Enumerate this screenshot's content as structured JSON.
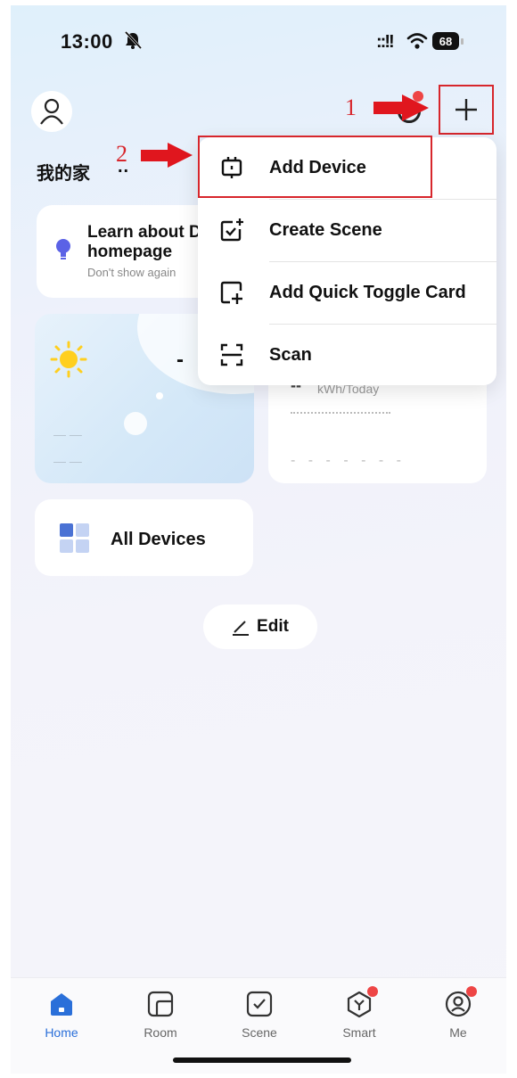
{
  "status_bar": {
    "time": "13:00",
    "signal": "::!!",
    "battery": "68"
  },
  "header": {
    "home_title": "我的家",
    "home_dots": ".."
  },
  "annotations": {
    "one": "1",
    "two": "2"
  },
  "diy_card": {
    "title": "Learn about DIY homepage",
    "subtitle": "Don't show again"
  },
  "weather_card": {
    "temp": "-",
    "lines": "— —"
  },
  "energy_card": {
    "value": "--",
    "unit": "kWh/Today",
    "placeholder": "- - - - - - -"
  },
  "all_devices": {
    "label": "All Devices"
  },
  "edit_button": {
    "label": "Edit"
  },
  "menu": {
    "items": [
      {
        "label": "Add Device",
        "icon": "device-icon"
      },
      {
        "label": "Create Scene",
        "icon": "create-scene-icon"
      },
      {
        "label": "Add Quick Toggle Card",
        "icon": "quick-toggle-card-icon"
      },
      {
        "label": "Scan",
        "icon": "scan-icon"
      }
    ]
  },
  "tabs": [
    {
      "label": "Home",
      "active": true
    },
    {
      "label": "Room",
      "active": false
    },
    {
      "label": "Scene",
      "active": false
    },
    {
      "label": "Smart",
      "active": false,
      "badge": true
    },
    {
      "label": "Me",
      "active": false,
      "badge": true
    }
  ],
  "colors": {
    "accent": "#2a6fd9",
    "annotation_red": "#d7262c",
    "badge_red": "#ee4545"
  }
}
